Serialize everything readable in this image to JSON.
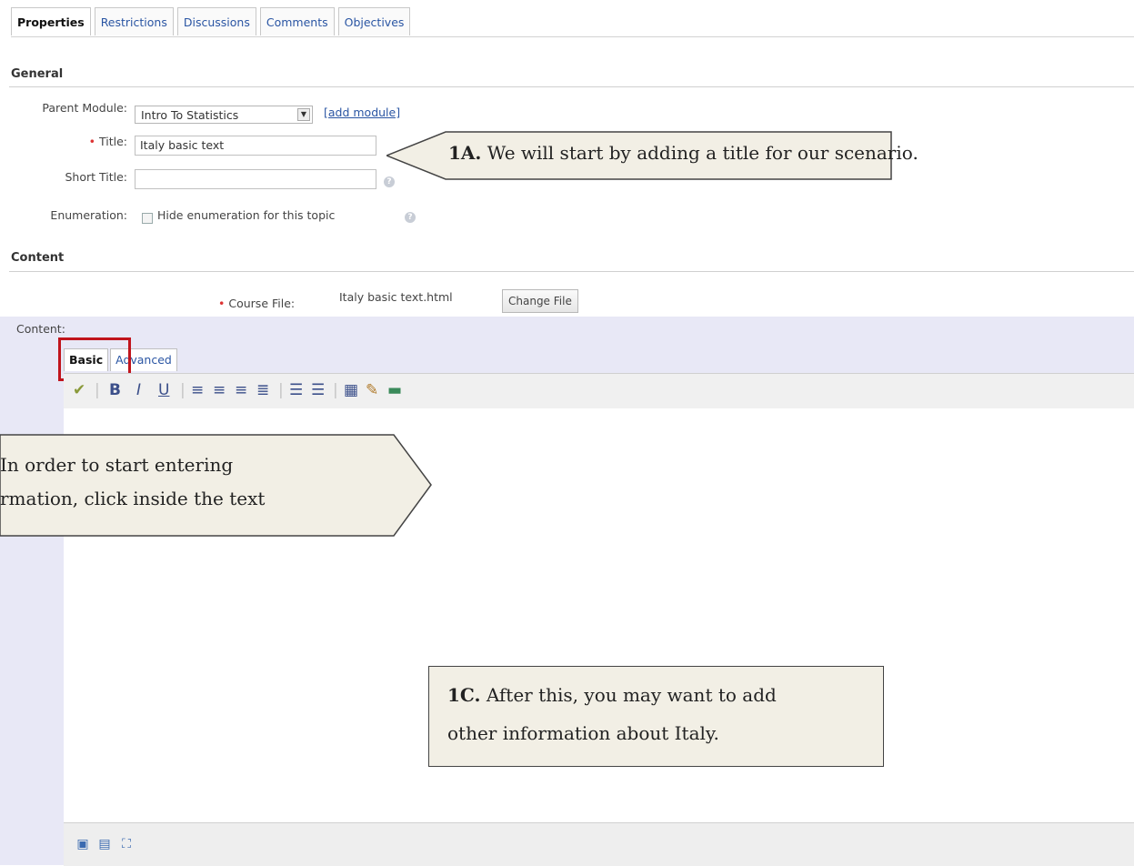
{
  "tabs": [
    "Properties",
    "Restrictions",
    "Discussions",
    "Comments",
    "Objectives"
  ],
  "general": {
    "heading": "General",
    "parent_module_label": "Parent Module:",
    "parent_module_value": "Intro To Statistics",
    "add_module_link": "[add module]",
    "title_label": "Title:",
    "title_value": "Italy basic text",
    "short_title_label": "Short Title:",
    "short_title_value": "",
    "enumeration_label": "Enumeration:",
    "enumeration_checkbox_label": "Hide enumeration for this topic"
  },
  "content": {
    "heading": "Content",
    "course_file_label": "Course File:",
    "course_file_value": "Italy basic text.html",
    "change_file_button": "Change File",
    "content_label": "Content:",
    "editor_tabs": [
      "Basic",
      "Advanced"
    ]
  },
  "icons": {
    "toolbar": [
      "spellcheck-icon",
      "bold-icon",
      "italic-icon",
      "underline-icon",
      "align-left-icon",
      "align-center-icon",
      "align-right-icon",
      "align-justify-icon",
      "bullet-list-icon",
      "numbered-list-icon",
      "table-icon",
      "link-icon",
      "image-icon"
    ],
    "footer": [
      "preview-icon",
      "find-icon",
      "fullscreen-icon"
    ]
  },
  "callouts": {
    "c1a_bold": "1A.",
    "c1a_text": "We will start by adding a title for our scenario.",
    "c1b_line1": "In order to start entering",
    "c1b_line2": "rmation, click inside the text",
    "c1c_bold": "1C.",
    "c1c_line1": "After this, you may want to add",
    "c1c_line2": "other information about Italy."
  },
  "colors": {
    "link": "#2a55a3",
    "required": "#dd3333",
    "highlight": "#c0141c",
    "editor_band": "#e8e8f6",
    "callout_bg": "#f2efe5"
  }
}
